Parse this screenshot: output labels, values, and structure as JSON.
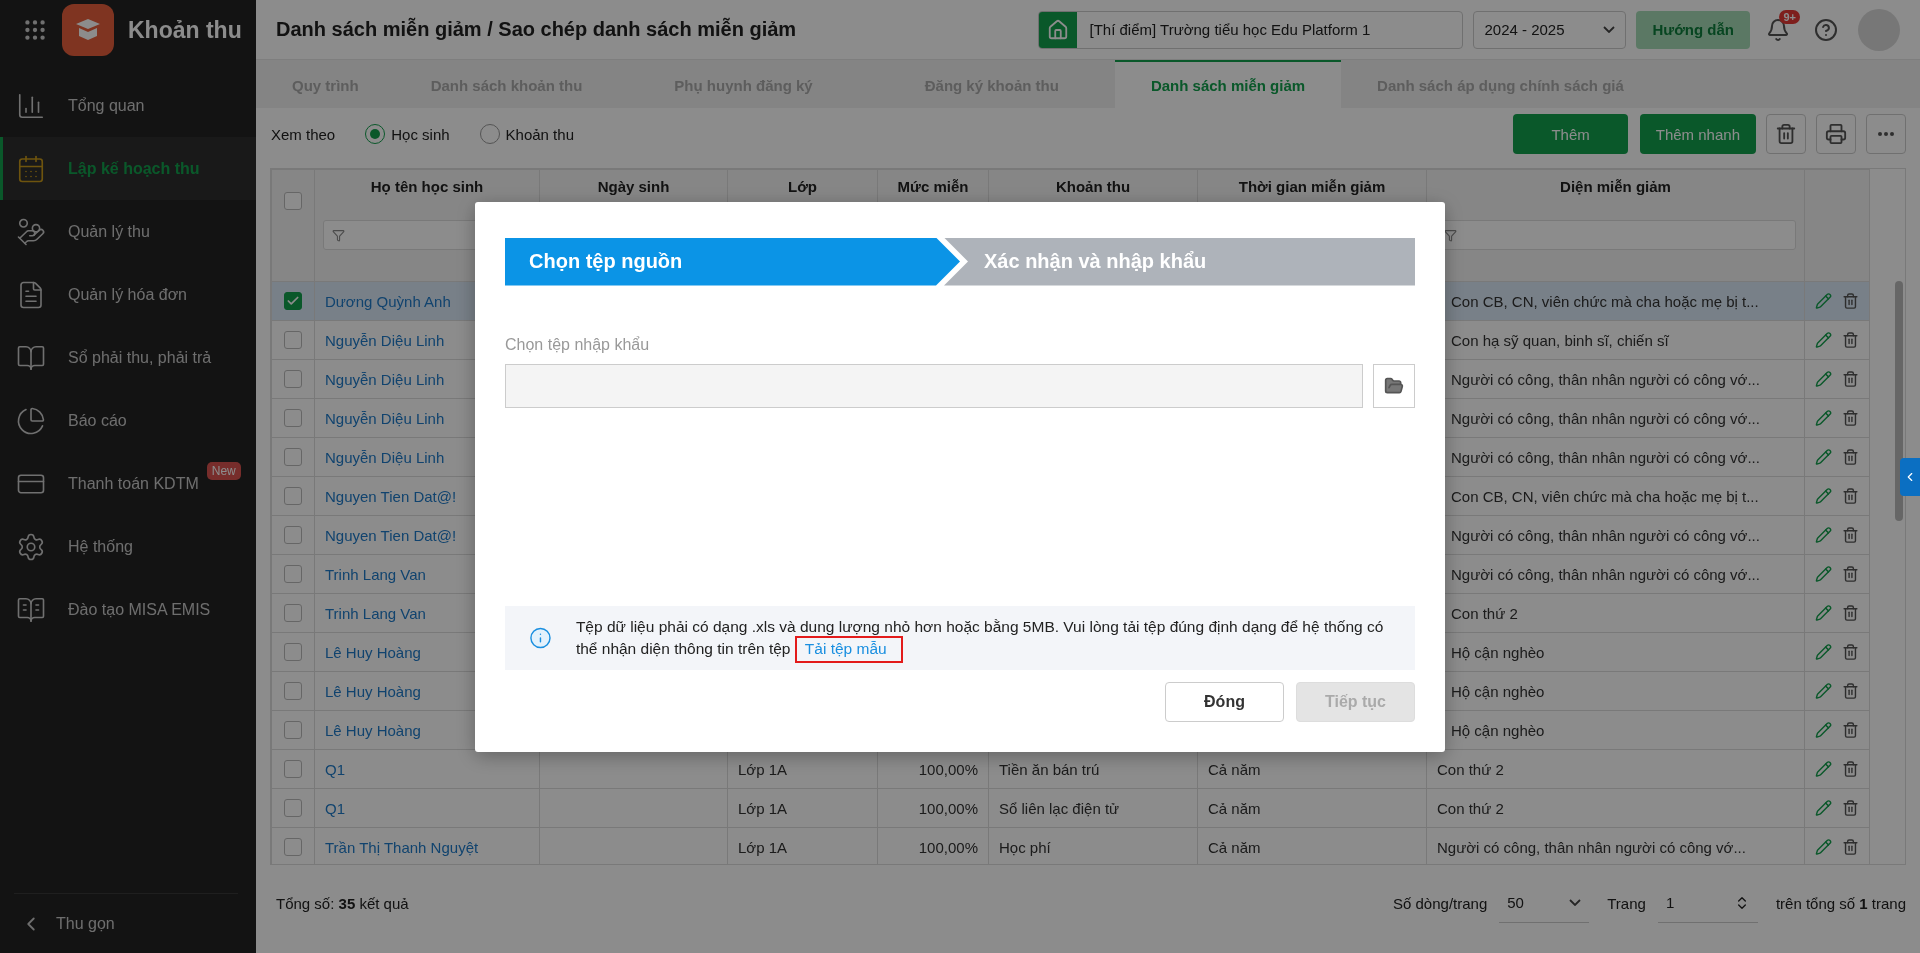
{
  "app": {
    "name": "Khoản thu"
  },
  "page_title": "Danh sách miễn giảm / Sao chép danh sách miễn giảm",
  "school_select": {
    "value": "[Thí điểm] Trường tiểu học Edu Platform 1"
  },
  "year_select": {
    "value": "2024 - 2025"
  },
  "help_button": "Hướng dẫn",
  "notifications": {
    "badge": "9+"
  },
  "sidebar": {
    "items": [
      {
        "label": "Tổng quan",
        "selected": false
      },
      {
        "label": "Lập kế hoạch thu",
        "selected": true
      },
      {
        "label": "Quản lý thu",
        "selected": false
      },
      {
        "label": "Quản lý hóa đơn",
        "selected": false
      },
      {
        "label": "Sổ phải thu, phải trả",
        "selected": false
      },
      {
        "label": "Báo cáo",
        "selected": false
      },
      {
        "label": "Thanh toán KDTM",
        "selected": false,
        "badge": "New"
      },
      {
        "label": "Hệ thống",
        "selected": false
      },
      {
        "label": "Đào tạo MISA EMIS",
        "selected": false
      }
    ],
    "collapse": "Thu gọn"
  },
  "tabs": [
    {
      "label": "Quy trình",
      "selected": false
    },
    {
      "label": "Danh sách khoản thu",
      "selected": false
    },
    {
      "label": "Phụ huynh đăng ký",
      "selected": false
    },
    {
      "label": "Đăng ký khoản thu",
      "selected": false
    },
    {
      "label": "Danh sách miễn giảm",
      "selected": true
    },
    {
      "label": "Danh sách áp dụng chính sách giá",
      "selected": false
    }
  ],
  "toolbar": {
    "view_by": {
      "label": "Xem theo",
      "options": [
        {
          "label": "Học sinh",
          "selected": true
        },
        {
          "label": "Khoản thu",
          "selected": false
        }
      ]
    },
    "add_button": "Thêm",
    "quick_add_button": "Thêm nhanh"
  },
  "table": {
    "select_all": {
      "checked": false
    },
    "columns": [
      {
        "label": "Họ tên học sinh"
      },
      {
        "label": "Ngày sinh"
      },
      {
        "label": "Lớp"
      },
      {
        "label": "Mức miễn"
      },
      {
        "label": "Khoản thu"
      },
      {
        "label": "Thời gian miễn giảm"
      },
      {
        "label": "Diện miễn giảm"
      }
    ],
    "rows": [
      {
        "selected": true,
        "name": "Dương Quỳnh Anh",
        "category": "Con CB, CN, viên chức mà cha hoặc mẹ bị t..."
      },
      {
        "selected": false,
        "name": "Nguyễn Diệu Linh",
        "category": "Con hạ sỹ quan, binh sĩ, chiến sĩ"
      },
      {
        "selected": false,
        "name": "Nguyễn Diệu Linh",
        "category": "Người có công, thân nhân người có công vớ..."
      },
      {
        "selected": false,
        "name": "Nguyễn Diệu Linh",
        "category": "Người có công, thân nhân người có công vớ..."
      },
      {
        "selected": false,
        "name": "Nguyễn Diệu Linh",
        "category": "Người có công, thân nhân người có công vớ..."
      },
      {
        "selected": false,
        "name": "Nguyen Tien Dat@!",
        "category": "Con CB, CN, viên chức mà cha hoặc mẹ bị t..."
      },
      {
        "selected": false,
        "name": "Nguyen Tien Dat@!",
        "category": "Người có công, thân nhân người có công vớ..."
      },
      {
        "selected": false,
        "name": "Trinh Lang Van",
        "category": "Người có công, thân nhân người có công vớ..."
      },
      {
        "selected": false,
        "name": "Trinh Lang Van",
        "category": "Con thứ 2"
      },
      {
        "selected": false,
        "name": "Lê Huy Hoàng",
        "category": "Hộ cận nghèo"
      },
      {
        "selected": false,
        "name": "Lê Huy Hoàng",
        "category": "Hộ cận nghèo"
      },
      {
        "selected": false,
        "name": "Lê Huy Hoàng",
        "category": "Hộ cận nghèo"
      },
      {
        "selected": false,
        "name": "Q1",
        "class": "Lớp 1A",
        "rate": "100,00%",
        "fee": "Tiền ăn bán trú",
        "period": "Cả năm",
        "category": "Con thứ 2"
      },
      {
        "selected": false,
        "name": "Q1",
        "class": "Lớp 1A",
        "rate": "100,00%",
        "fee": "Sổ liên lạc điện tử",
        "period": "Cả năm",
        "category": "Con thứ 2"
      },
      {
        "selected": false,
        "name": "Trần Thị Thanh Nguyệt",
        "class": "Lớp 1A",
        "rate": "100,00%",
        "fee": "Học phí",
        "period": "Cả năm",
        "category": "Người có công, thân nhân người có công vớ..."
      }
    ]
  },
  "footer": {
    "total": "Tổng số: **35** kết quả",
    "page_size_label": "Số dòng/trang",
    "page_size": "50",
    "page_label": "Trang",
    "page": "1",
    "page_total": "trên tổng số **1** trang"
  },
  "dialog": {
    "steps": [
      {
        "label": "Chọn tệp nguồn",
        "selected": true
      },
      {
        "label": "Xác nhận và nhập khẩu",
        "selected": false
      }
    ],
    "file_label": "Chọn tệp nhập khẩu",
    "info": {
      "text": "Tệp dữ liệu phải có dạng .xls và dung lượng nhỏ hơn hoặc bằng 5MB. Vui lòng tải tệp đúng định dạng để hệ thống có thể nhận diện thông tin trên tệp",
      "link": "Tải tệp mẫu",
      "link_highlighted": true
    },
    "buttons": [
      {
        "label": "Đóng",
        "disabled": false
      },
      {
        "label": "Tiếp tục",
        "disabled": true
      }
    ]
  }
}
